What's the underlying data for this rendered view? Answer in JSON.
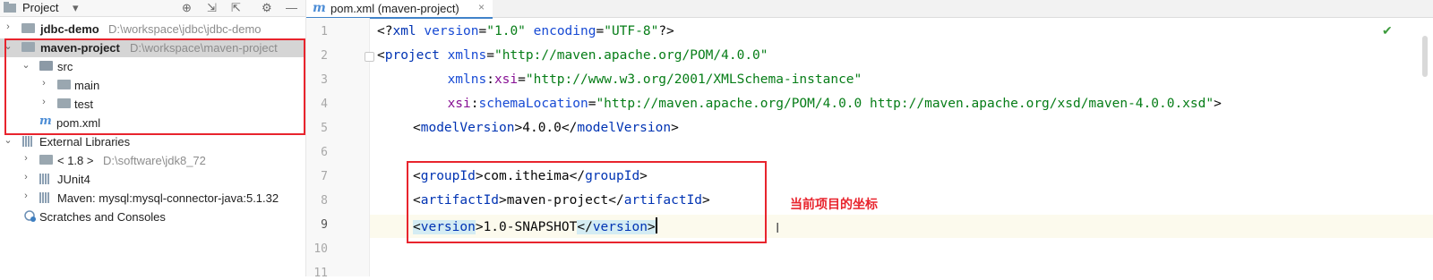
{
  "project_panel": {
    "title": "Project",
    "title_arrow": "▾",
    "toolbar_icons": {
      "target": "⊕",
      "expand": "⇲",
      "collapse": "⇱",
      "settings": "⚙",
      "minimize": "—"
    },
    "tree": [
      {
        "label": "jdbc-demo",
        "path": "D:\\workspace\\jdbc\\jdbc-demo",
        "expanded": false
      },
      {
        "label": "maven-project",
        "path": "D:\\workspace\\maven-project",
        "expanded": true,
        "selected": true
      },
      {
        "label": "src",
        "expanded": true
      },
      {
        "label": "main",
        "expanded": false
      },
      {
        "label": "test",
        "expanded": false
      },
      {
        "label": "pom.xml"
      },
      {
        "label": "External Libraries",
        "expanded": true
      },
      {
        "label": "< 1.8 >",
        "path": "D:\\software\\jdk8_72",
        "expanded": false
      },
      {
        "label": "JUnit4",
        "expanded": false
      },
      {
        "label": "Maven: mysql:mysql-connector-java:5.1.32",
        "expanded": false
      },
      {
        "label": "Scratches and Consoles"
      }
    ]
  },
  "editor": {
    "tab_label": "pom.xml (maven-project)",
    "tab_close": "×",
    "line_numbers": [
      "1",
      "2",
      "3",
      "4",
      "5",
      "6",
      "7",
      "8",
      "9",
      "10",
      "11"
    ],
    "lines": {
      "l1": {
        "a": "<?",
        "b": "xml",
        "c": " version",
        "d": "=",
        "e": "\"1.0\"",
        "f": " encoding",
        "g": "=",
        "h": "\"UTF-8\"",
        "i": "?>"
      },
      "l2": {
        "a": "<",
        "b": "project",
        "c": " xmlns",
        "d": "=",
        "e": "\"http://maven.apache.org/POM/4.0.0\""
      },
      "l3": {
        "a": "         xmlns",
        "b": ":",
        "c": "xsi",
        "d": "=",
        "e": "\"http://www.w3.org/2001/XMLSchema-instance\""
      },
      "l4": {
        "a": "         xsi",
        "b": ":",
        "c": "schemaLocation",
        "d": "=",
        "e": "\"http://maven.apache.org/POM/4.0.0 http://maven.apache.org/xsd/maven-4.0.0.xsd\"",
        "f": ">"
      },
      "l5": {
        "a": "<",
        "b": "modelVersion",
        "c": ">4.0.0</",
        "d": "modelVersion",
        "e": ">"
      },
      "l7": {
        "a": "<",
        "b": "groupId",
        "c": ">com.itheima</",
        "d": "groupId",
        "e": ">"
      },
      "l8": {
        "a": "<",
        "b": "artifactId",
        "c": ">maven-project</",
        "d": "artifactId",
        "e": ">"
      },
      "l9": {
        "a": "<",
        "b": "version",
        "c": ">",
        "d": "1.0-SNAPSHOT",
        "e": "</",
        "f": "version",
        "g": ">"
      }
    },
    "annotation": "当前项目的坐标",
    "status_check": "✔"
  }
}
